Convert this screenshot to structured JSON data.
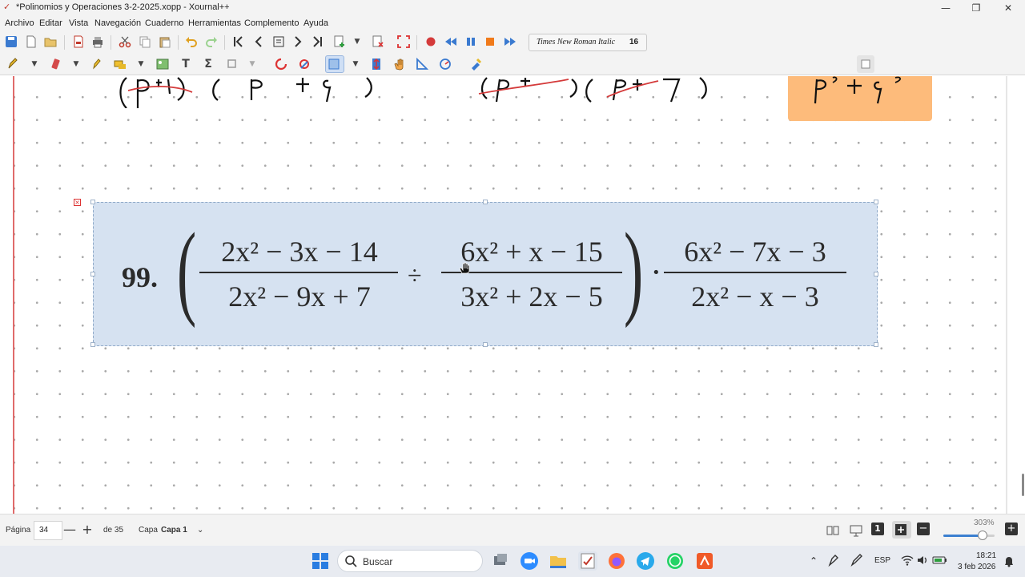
{
  "window": {
    "title": "*Polinomios y Operaciones 3-2-2025.xopp - Xournal++",
    "minimize": "—",
    "maximize": "❐",
    "close": "✕"
  },
  "menu": [
    "Archivo",
    "Editar",
    "Vista",
    "Navegación",
    "Cuaderno",
    "Herramientas",
    "Complemento",
    "Ayuda"
  ],
  "toolbar": {
    "font_name": "Times New Roman Italic",
    "font_size": "16",
    "pen_colors": [
      "#7a7a7a",
      "#5aa55a",
      "#59c2e8",
      "#6ad66a",
      "#8a76c9",
      "#a0a0a0",
      "#e55d5d",
      "#e84fe0",
      "#f0a34a",
      "#f2e24a",
      "#ffffff"
    ],
    "accent_color": "#3a7ad0",
    "record_color": "#d43a3a"
  },
  "canvas": {
    "sticky_color": "#fdbb7b",
    "selection_fill": "#d6e2f1"
  },
  "formula": {
    "number": "99.",
    "f1_num": "2x² − 3x − 14",
    "f1_den": "2x² − 9x + 7",
    "divide": "÷",
    "f2_num": "6x² + x − 15",
    "f2_den": "3x² + 2x − 5",
    "times": "·",
    "f3_num": "6x² − 7x − 3",
    "f3_den": "2x² − x − 3",
    "lparen": "(",
    "rparen": ")"
  },
  "status": {
    "page_label": "Página",
    "page_value": "34",
    "minus": "—",
    "plus": "+",
    "of_pages": "de 35",
    "layer_label": "Capa",
    "layer_value": "Capa 1",
    "layer_dropdown": "⌄",
    "zoom": "303%",
    "page_number_icon": "1"
  },
  "taskbar": {
    "search_placeholder": "Buscar",
    "language": "ESP",
    "time": "18:21",
    "date": "3 feb 2026"
  }
}
